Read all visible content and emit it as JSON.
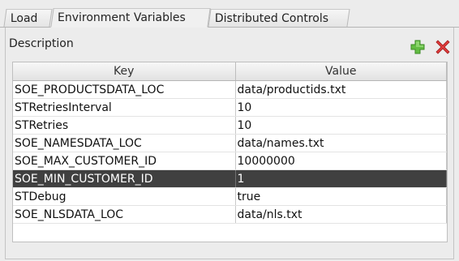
{
  "tabs": [
    {
      "label": "Load"
    },
    {
      "label": "Environment Variables"
    },
    {
      "label": "Distributed Controls"
    }
  ],
  "active_tab": "Environment Variables",
  "section": {
    "label": "Description"
  },
  "icons": {
    "add": "plus-icon",
    "remove": "x-icon",
    "add_color": "#5fb83b",
    "remove_color": "#d92b2b"
  },
  "table": {
    "columns": [
      "Key",
      "Value"
    ],
    "rows": [
      {
        "key": "SOE_PRODUCTSDATA_LOC",
        "value": "data/productids.txt"
      },
      {
        "key": "STRetriesInterval",
        "value": "10"
      },
      {
        "key": "STRetries",
        "value": "10"
      },
      {
        "key": "SOE_NAMESDATA_LOC",
        "value": "data/names.txt"
      },
      {
        "key": "SOE_MAX_CUSTOMER_ID",
        "value": "10000000"
      },
      {
        "key": "SOE_MIN_CUSTOMER_ID",
        "value": "1"
      },
      {
        "key": "STDebug",
        "value": "true"
      },
      {
        "key": "SOE_NLSDATA_LOC",
        "value": "data/nls.txt"
      }
    ],
    "selected_row": "SOE_MIN_CUSTOMER_ID"
  },
  "colors": {
    "selection": "#404040",
    "panel_bg": "#ececec"
  }
}
